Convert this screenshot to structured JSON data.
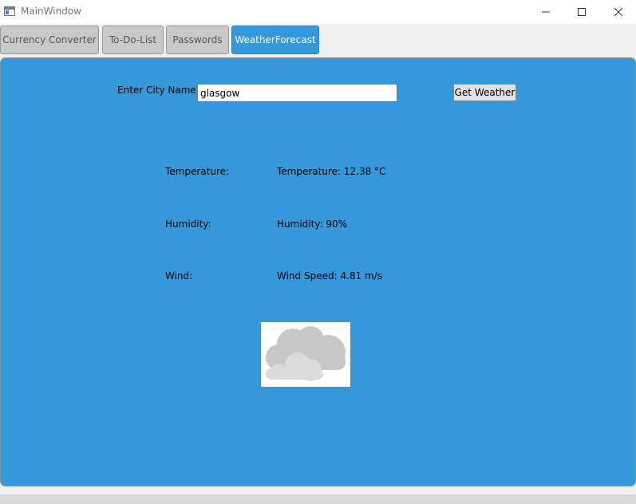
{
  "window": {
    "title": "MainWindow",
    "icon": "app-window-icon",
    "controls": [
      "minimize-icon",
      "maximize-icon",
      "close-icon"
    ]
  },
  "tabs": [
    {
      "label": "Currency Converter",
      "active": false
    },
    {
      "label": "To-Do-List",
      "active": false
    },
    {
      "label": "Passwords",
      "active": false
    },
    {
      "label": "WeatherForecast",
      "active": true
    }
  ],
  "weather": {
    "city_label": "Enter City Name:",
    "city_value": "glasgow",
    "button_label": "Get Weather",
    "rows": [
      {
        "label": "Temperature:",
        "value": "Temperature: 12.38 °C"
      },
      {
        "label": "Humidity:",
        "value": "Humidity: 90%"
      },
      {
        "label": "Wind:",
        "value": "Wind Speed: 4.81 m/s"
      }
    ],
    "image_icon": "cloudy-icon"
  },
  "colors": {
    "accent": "#3598db",
    "tab_inactive": "#c9c9c9",
    "background": "#f0f0f0"
  }
}
